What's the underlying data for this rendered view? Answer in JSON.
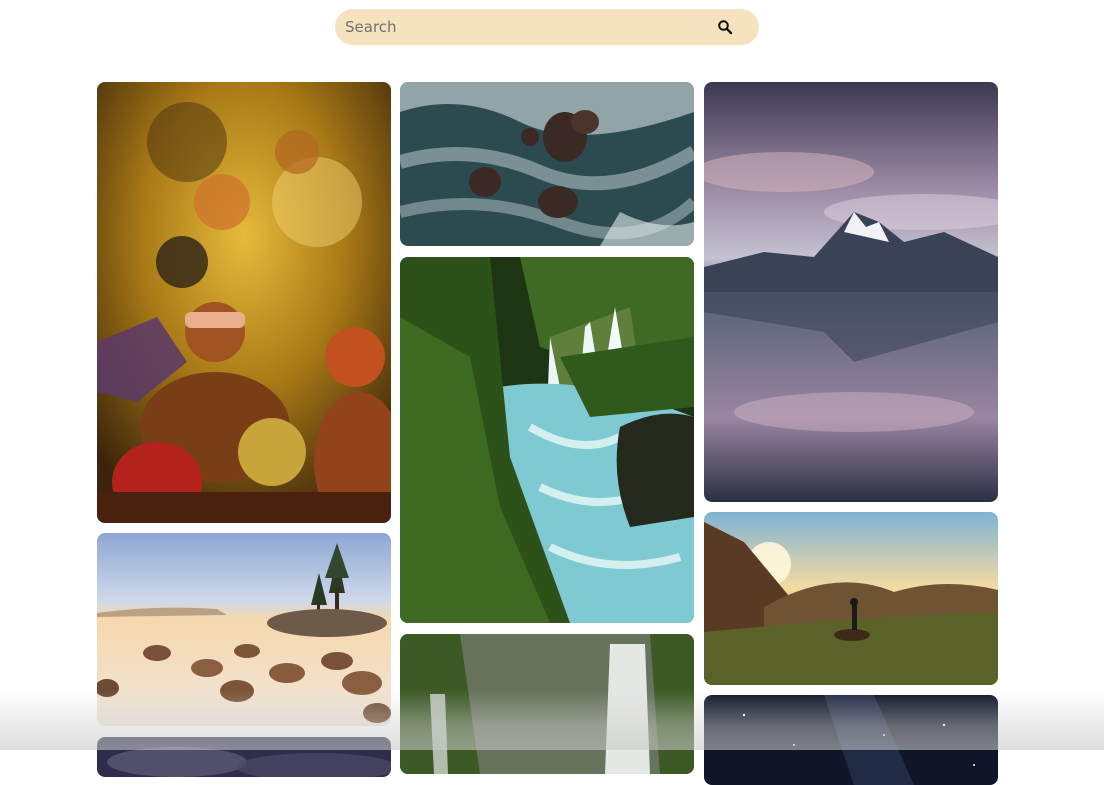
{
  "search": {
    "placeholder": "Search",
    "value": "",
    "icon": "search-icon"
  },
  "gallery": {
    "columns": [
      {
        "photos": [
          {
            "subject": "festival-crowd-colored-powder",
            "colors": [
              "#3a240c",
              "#c99a1c",
              "#e0b43a"
            ]
          },
          {
            "subject": "lake-rocks-pine-trees",
            "colors": [
              "#9fb3d6",
              "#f3d7b0",
              "#5a4634"
            ]
          },
          {
            "subject": "night-sky-clouds",
            "colors": [
              "#2f2e4a",
              "#5f5e7a"
            ]
          }
        ]
      },
      {
        "photos": [
          {
            "subject": "aerial-ocean-waves-rocks",
            "colors": [
              "#2c4b51",
              "#5d8288",
              "#3b2a24"
            ]
          },
          {
            "subject": "forest-waterfall-turquoise-river",
            "colors": [
              "#1e3514",
              "#4e7a2c",
              "#7fcad2"
            ]
          },
          {
            "subject": "misty-forest-waterfall",
            "colors": [
              "#2b3b1f",
              "#8f9a86",
              "#dfe3df"
            ]
          }
        ]
      },
      {
        "photos": [
          {
            "subject": "snowy-mountain-lake-reflection",
            "colors": [
              "#3c3852",
              "#9b8aa4",
              "#2b3042"
            ]
          },
          {
            "subject": "hiker-mountain-sunrise",
            "colors": [
              "#7fb2d4",
              "#f7dca0",
              "#4e5224"
            ]
          },
          {
            "subject": "milky-way-night-sky",
            "colors": [
              "#101628",
              "#2b3552"
            ]
          }
        ]
      }
    ]
  }
}
